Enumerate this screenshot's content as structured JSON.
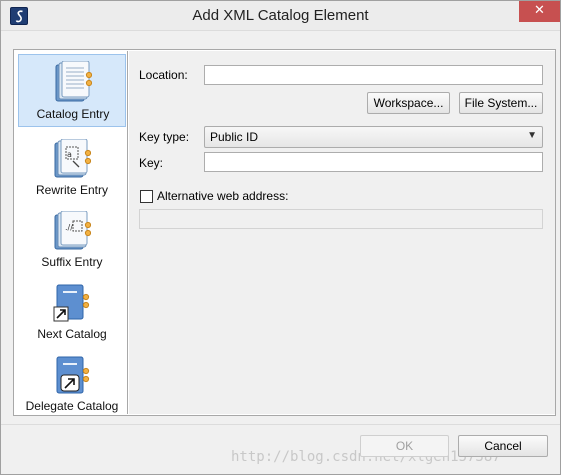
{
  "window": {
    "title": "Add XML Catalog Element",
    "close_symbol": "✕"
  },
  "sidebar": {
    "items": [
      {
        "label": "Catalog Entry",
        "icon": "catalog-entry-icon",
        "selected": true
      },
      {
        "label": "Rewrite Entry",
        "icon": "rewrite-entry-icon",
        "selected": false
      },
      {
        "label": "Suffix Entry",
        "icon": "suffix-entry-icon",
        "selected": false
      },
      {
        "label": "Next Catalog",
        "icon": "next-catalog-icon",
        "selected": false
      },
      {
        "label": "Delegate Catalog",
        "icon": "delegate-catalog-icon",
        "selected": false
      }
    ]
  },
  "form": {
    "location_label": "Location:",
    "location_value": "",
    "workspace_button": "Workspace...",
    "filesystem_button": "File System...",
    "keytype_label": "Key type:",
    "keytype_value": "Public ID",
    "key_label": "Key:",
    "key_value": "",
    "alt_web_label": "Alternative web address:",
    "alt_web_checked": false,
    "alt_web_value": ""
  },
  "footer": {
    "ok_label": "OK",
    "cancel_label": "Cancel",
    "watermark": "http://blog.csdn.net/xlgen157387"
  },
  "colors": {
    "selection_bg": "#d6e8fa",
    "close_button": "#c75050",
    "app_icon": "#1f3d73"
  }
}
